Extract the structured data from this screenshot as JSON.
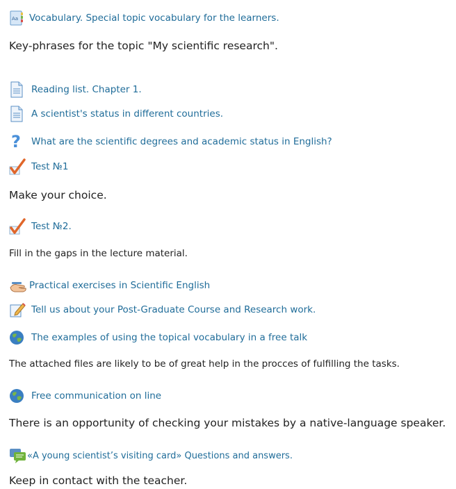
{
  "items": [
    {
      "icon": "glossary-icon",
      "link": "Vocabulary. Special topic vocabulary for the learners.",
      "description": "Key-phrases for the topic \"My scientific research\"."
    },
    {
      "icon": "page-icon",
      "link": "Reading list. Chapter 1."
    },
    {
      "icon": "page-icon",
      "link": " A scientist's status in different countries."
    },
    {
      "icon": "question-icon",
      "link": "What are the scientific degrees and academic status in English?"
    },
    {
      "icon": "quiz-checkmark-icon",
      "link": "Test №1",
      "description": "Make your choice."
    },
    {
      "icon": "quiz-checkmark-icon",
      "link": "Test №2.",
      "description": "Fill in the gaps in  the lecture material."
    },
    {
      "icon": "workshop-hand-icon",
      "link": "Practical exercises in Scientific English"
    },
    {
      "icon": "assignment-pencil-icon",
      "link": "Tell us about your Post-Graduate Course and Research work."
    },
    {
      "icon": "globe-icon",
      "link": "The examples of using the topical vocabulary in a free talk",
      "description": "The attached files are likely to be of great help in the procces of fulfilling the tasks."
    },
    {
      "icon": "globe-icon",
      "link": "Free communication on line",
      "description": "There is an opportunity of checking your mistakes by a native-language speaker."
    },
    {
      "icon": "forum-chat-icon",
      "link": "«A young scientist’s visiting card» Questions and answers.",
      "description": "Keep in contact with the teacher."
    }
  ],
  "colors": {
    "link": "#1f6c99",
    "text": "#222222",
    "checkmark": "#e0662a",
    "globe": "#3a7fc1",
    "question": "#4a90d9",
    "chat": "#6fb33b"
  }
}
